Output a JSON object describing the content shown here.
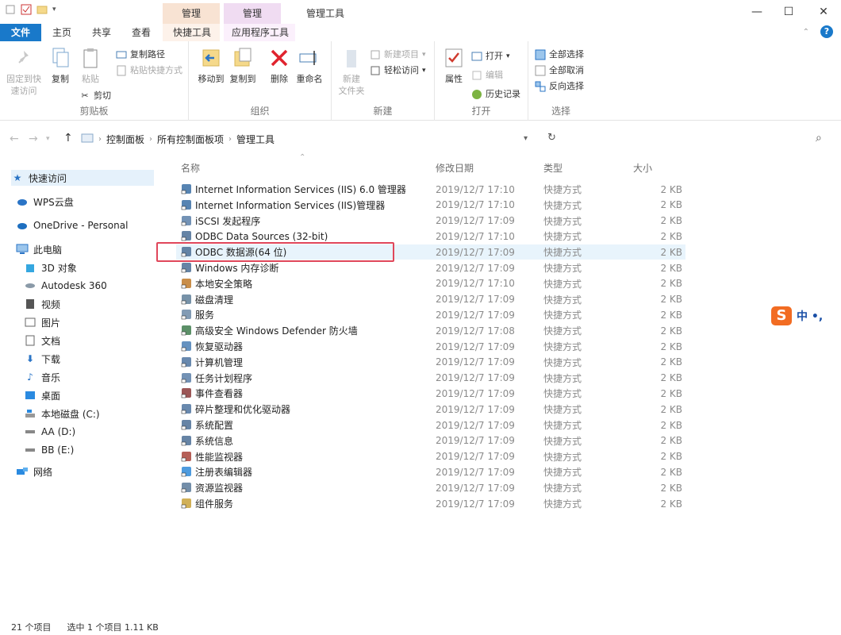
{
  "window": {
    "title": "管理工具",
    "context_tab_1": "管理",
    "context_tab_2": "管理",
    "minimize": "—",
    "maximize": "☐",
    "close": "✕"
  },
  "ribbon_tabs": {
    "file": "文件",
    "home": "主页",
    "share": "共享",
    "view": "查看",
    "shortcut_tools": "快捷工具",
    "app_tools": "应用程序工具"
  },
  "ribbon": {
    "clipboard": {
      "label": "剪贴板",
      "pin": "固定到快\n速访问",
      "copy": "复制",
      "paste": "粘贴",
      "copy_path": "复制路径",
      "paste_shortcut": "粘贴快捷方式",
      "cut": "剪切"
    },
    "organize": {
      "label": "组织",
      "move_to": "移动到",
      "copy_to": "复制到",
      "delete": "删除",
      "rename": "重命名"
    },
    "new": {
      "label": "新建",
      "new_folder": "新建\n文件夹",
      "new_item": "新建项目",
      "easy_access": "轻松访问"
    },
    "open": {
      "label": "打开",
      "properties": "属性",
      "open": "打开",
      "edit": "编辑",
      "history": "历史记录"
    },
    "select": {
      "label": "选择",
      "select_all": "全部选择",
      "select_none": "全部取消",
      "invert": "反向选择"
    }
  },
  "address": {
    "crumbs": [
      "控制面板",
      "所有控制面板项",
      "管理工具"
    ]
  },
  "nav": {
    "quick_access": "快速访问",
    "wps": "WPS云盘",
    "onedrive": "OneDrive - Personal",
    "this_pc": "此电脑",
    "objects3d": "3D 对象",
    "autodesk": "Autodesk 360",
    "videos": "视频",
    "pictures": "图片",
    "documents": "文档",
    "downloads": "下载",
    "music": "音乐",
    "desktop": "桌面",
    "drive_c": "本地磁盘 (C:)",
    "drive_d": "AA (D:)",
    "drive_e": "BB (E:)",
    "network": "网络"
  },
  "columns": {
    "name": "名称",
    "date": "修改日期",
    "type": "类型",
    "size": "大小"
  },
  "files": [
    {
      "name": "Internet Information Services (IIS) 6.0 管理器",
      "date": "2019/12/7 17:10",
      "type": "快捷方式",
      "size": "2 KB"
    },
    {
      "name": "Internet Information Services (IIS)管理器",
      "date": "2019/12/7 17:10",
      "type": "快捷方式",
      "size": "2 KB"
    },
    {
      "name": "iSCSI 发起程序",
      "date": "2019/12/7 17:09",
      "type": "快捷方式",
      "size": "2 KB"
    },
    {
      "name": "ODBC Data Sources (32-bit)",
      "date": "2019/12/7 17:10",
      "type": "快捷方式",
      "size": "2 KB"
    },
    {
      "name": "ODBC 数据源(64 位)",
      "date": "2019/12/7 17:09",
      "type": "快捷方式",
      "size": "2 KB"
    },
    {
      "name": "Windows 内存诊断",
      "date": "2019/12/7 17:09",
      "type": "快捷方式",
      "size": "2 KB"
    },
    {
      "name": "本地安全策略",
      "date": "2019/12/7 17:10",
      "type": "快捷方式",
      "size": "2 KB"
    },
    {
      "name": "磁盘清理",
      "date": "2019/12/7 17:09",
      "type": "快捷方式",
      "size": "2 KB"
    },
    {
      "name": "服务",
      "date": "2019/12/7 17:09",
      "type": "快捷方式",
      "size": "2 KB"
    },
    {
      "name": "高级安全 Windows Defender 防火墙",
      "date": "2019/12/7 17:08",
      "type": "快捷方式",
      "size": "2 KB"
    },
    {
      "name": "恢复驱动器",
      "date": "2019/12/7 17:09",
      "type": "快捷方式",
      "size": "2 KB"
    },
    {
      "name": "计算机管理",
      "date": "2019/12/7 17:09",
      "type": "快捷方式",
      "size": "2 KB"
    },
    {
      "name": "任务计划程序",
      "date": "2019/12/7 17:09",
      "type": "快捷方式",
      "size": "2 KB"
    },
    {
      "name": "事件查看器",
      "date": "2019/12/7 17:09",
      "type": "快捷方式",
      "size": "2 KB"
    },
    {
      "name": "碎片整理和优化驱动器",
      "date": "2019/12/7 17:09",
      "type": "快捷方式",
      "size": "2 KB"
    },
    {
      "name": "系统配置",
      "date": "2019/12/7 17:09",
      "type": "快捷方式",
      "size": "2 KB"
    },
    {
      "name": "系统信息",
      "date": "2019/12/7 17:09",
      "type": "快捷方式",
      "size": "2 KB"
    },
    {
      "name": "性能监视器",
      "date": "2019/12/7 17:09",
      "type": "快捷方式",
      "size": "2 KB"
    },
    {
      "name": "注册表编辑器",
      "date": "2019/12/7 17:09",
      "type": "快捷方式",
      "size": "2 KB"
    },
    {
      "name": "资源监视器",
      "date": "2019/12/7 17:09",
      "type": "快捷方式",
      "size": "2 KB"
    },
    {
      "name": "组件服务",
      "date": "2019/12/7 17:09",
      "type": "快捷方式",
      "size": "2 KB"
    }
  ],
  "selected_file": "ODBC 数据源(64 位)",
  "ime": {
    "logo": "S",
    "text": "中 •,"
  },
  "status": {
    "count": "21 个项目",
    "selection": "选中 1 个项目  1.11 KB"
  },
  "colors": {
    "accent": "#1979ca",
    "highlight_border": "#e0475b",
    "selected_row": "#e8f4fc"
  }
}
